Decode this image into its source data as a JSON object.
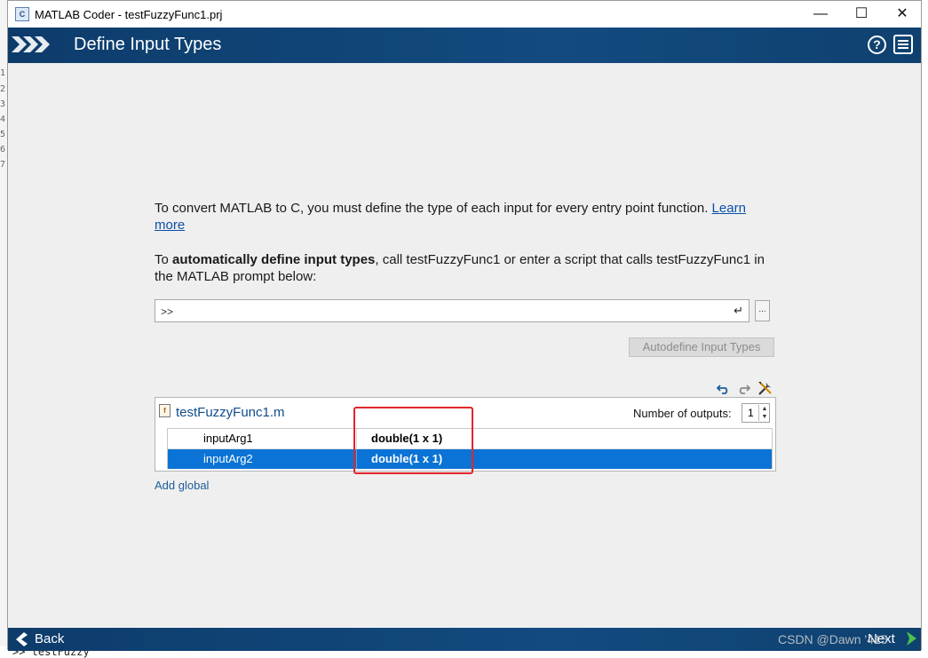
{
  "background": {
    "line_numbers": [
      "1",
      "2",
      "3",
      "4",
      "5",
      "6",
      "7"
    ],
    "bottom_text": ">> testFuzzy"
  },
  "window": {
    "title": "MATLAB Coder - testFuzzyFunc1.prj",
    "minimize_glyph": "—",
    "maximize_glyph": "☐",
    "close_glyph": "✕",
    "app_icon_glyph": "C"
  },
  "header": {
    "title": "Define Input Types",
    "help_glyph": "?"
  },
  "intro": {
    "text": "To convert MATLAB to C, you must define the type of each input for every entry point function. ",
    "link": "Learn more"
  },
  "auto": {
    "prefix": "To ",
    "bold": "automatically define input types",
    "suffix": ", call testFuzzyFunc1 or enter a script that calls testFuzzyFunc1 in the MATLAB prompt below:"
  },
  "prompt": {
    "value": ">>",
    "enter_glyph": "↵",
    "more_label": "..."
  },
  "autodefine_label": "Autodefine Input Types",
  "toolbar_icons": [
    "undo-icon",
    "redo-icon",
    "tools-icon"
  ],
  "function": {
    "name": "testFuzzyFunc1.m",
    "outputs_label": "Number of outputs:",
    "outputs_value": "1",
    "args": [
      {
        "name": "inputArg1",
        "type": "double(1 x 1)"
      },
      {
        "name": "inputArg2",
        "type": "double(1 x 1)"
      }
    ]
  },
  "add_global_label": "Add global",
  "footer": {
    "back_label": "Back",
    "next_label": "Next"
  },
  "watermark": "CSDN @Dawn '415",
  "colors": {
    "header_bg": "#0d3c6b",
    "selection": "#0a73d5",
    "highlight_box": "#e0262b",
    "link": "#0b4fa8"
  }
}
